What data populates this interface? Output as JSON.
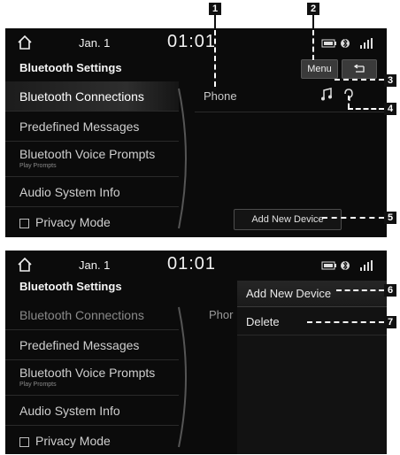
{
  "screen1": {
    "status": {
      "date": "Jan. 1",
      "time": "01:01"
    },
    "title": "Bluetooth Settings",
    "menu_button": "Menu",
    "back_button": "⮌",
    "menu_items": [
      {
        "label": "Bluetooth Connections"
      },
      {
        "label": "Predefined Messages"
      },
      {
        "label": "Bluetooth Voice Prompts",
        "sub": "Play Prompts"
      },
      {
        "label": "Audio System Info"
      },
      {
        "label": "Privacy Mode"
      }
    ],
    "device": {
      "name": "Phone"
    },
    "add_new_device": "Add New Device"
  },
  "screen2": {
    "status": {
      "date": "Jan. 1",
      "time": "01:01"
    },
    "title": "Bluetooth Settings",
    "menu_items": [
      {
        "label": "Bluetooth Connections"
      },
      {
        "label": "Predefined Messages"
      },
      {
        "label": "Bluetooth Voice Prompts",
        "sub": "Play Prompts"
      },
      {
        "label": "Audio System Info"
      },
      {
        "label": "Privacy Mode"
      }
    ],
    "device_partial": "Phor",
    "popup": [
      {
        "label": "Add New Device"
      },
      {
        "label": "Delete"
      }
    ]
  },
  "callouts": [
    "1",
    "2",
    "3",
    "4",
    "5",
    "6",
    "7"
  ],
  "icons": [
    "home-icon",
    "battery-icon",
    "bluetooth-icon",
    "signal-icon",
    "music-icon",
    "headset-icon",
    "back-icon"
  ]
}
